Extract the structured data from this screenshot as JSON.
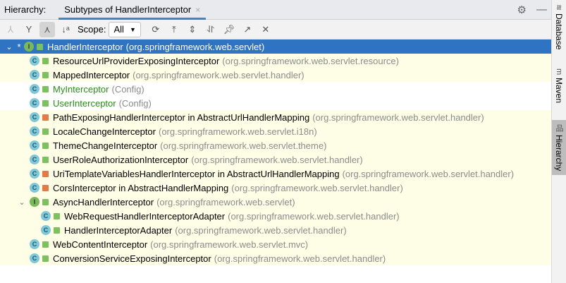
{
  "header": {
    "label": "Hierarchy:",
    "tab": "Subtypes of HandlerInterceptor",
    "close": "×",
    "gear": "⚙",
    "minimize": "—"
  },
  "toolbar": {
    "scope_label": "Scope:",
    "scope_value": "All"
  },
  "tree": [
    {
      "name": "HandlerInterceptor",
      "pkg": "(org.springframework.web.servlet)",
      "kind": "I",
      "depth": 0,
      "expanded": true,
      "selected": true,
      "star": "*",
      "access": "public",
      "bg": "sel"
    },
    {
      "name": "ResourceUrlProviderExposingInterceptor",
      "pkg": "(org.springframework.web.servlet.resource)",
      "kind": "C",
      "depth": 1,
      "access": "public",
      "bg": "yellow"
    },
    {
      "name": "MappedInterceptor",
      "pkg": "(org.springframework.web.servlet.handler)",
      "kind": "C",
      "depth": 1,
      "access": "public",
      "bg": "yellow"
    },
    {
      "name": "MyInterceptor",
      "pkg": "(Config)",
      "kind": "C",
      "depth": 1,
      "access": "public",
      "bg": "white",
      "green": true
    },
    {
      "name": "UserInterceptor",
      "pkg": "(Config)",
      "kind": "C",
      "depth": 1,
      "access": "public",
      "bg": "white",
      "green": true
    },
    {
      "name": "PathExposingHandlerInterceptor in AbstractUrlHandlerMapping",
      "pkg": "(org.springframework.web.servlet.handler)",
      "kind": "C",
      "depth": 1,
      "access": "private",
      "bg": "yellow"
    },
    {
      "name": "LocaleChangeInterceptor",
      "pkg": "(org.springframework.web.servlet.i18n)",
      "kind": "C",
      "depth": 1,
      "access": "public",
      "bg": "yellow"
    },
    {
      "name": "ThemeChangeInterceptor",
      "pkg": "(org.springframework.web.servlet.theme)",
      "kind": "C",
      "depth": 1,
      "access": "public",
      "bg": "yellow"
    },
    {
      "name": "UserRoleAuthorizationInterceptor",
      "pkg": "(org.springframework.web.servlet.handler)",
      "kind": "C",
      "depth": 1,
      "access": "public",
      "bg": "yellow"
    },
    {
      "name": "UriTemplateVariablesHandlerInterceptor in AbstractUrlHandlerMapping",
      "pkg": "(org.springframework.web.servlet.handler)",
      "kind": "C",
      "depth": 1,
      "access": "private",
      "bg": "yellow"
    },
    {
      "name": "CorsInterceptor in AbstractHandlerMapping",
      "pkg": "(org.springframework.web.servlet.handler)",
      "kind": "C",
      "depth": 1,
      "access": "private",
      "bg": "yellow"
    },
    {
      "name": "AsyncHandlerInterceptor",
      "pkg": "(org.springframework.web.servlet)",
      "kind": "I",
      "depth": 1,
      "expanded": true,
      "access": "public",
      "bg": "yellow"
    },
    {
      "name": "WebRequestHandlerInterceptorAdapter",
      "pkg": "(org.springframework.web.servlet.handler)",
      "kind": "C",
      "depth": 2,
      "access": "public",
      "bg": "yellow"
    },
    {
      "name": "HandlerInterceptorAdapter",
      "pkg": "(org.springframework.web.servlet.handler)",
      "kind": "C",
      "depth": 2,
      "access": "public",
      "bg": "yellow"
    },
    {
      "name": "WebContentInterceptor",
      "pkg": "(org.springframework.web.servlet.mvc)",
      "kind": "C",
      "depth": 1,
      "access": "public",
      "bg": "yellow"
    },
    {
      "name": "ConversionServiceExposingInterceptor",
      "pkg": "(org.springframework.web.servlet.handler)",
      "kind": "C",
      "depth": 1,
      "access": "public",
      "bg": "yellow"
    }
  ],
  "sidebar": [
    {
      "label": "Database",
      "icon": "≋"
    },
    {
      "label": "Maven",
      "icon": "m"
    },
    {
      "label": "Hierarchy",
      "icon": "品",
      "active": true
    }
  ]
}
